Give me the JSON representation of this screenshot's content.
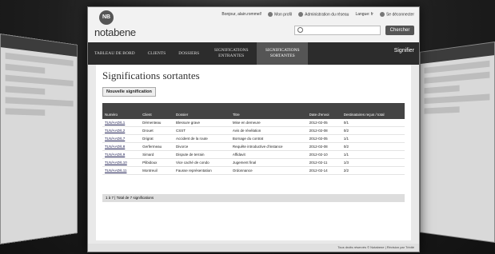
{
  "header": {
    "logo_badge": "NB",
    "logo_text": "notabene",
    "user_link": "Bonjour, alain.rommel!",
    "profile_link": "Mon profil",
    "admin_link": "Administration du réseau",
    "language": "Langue: fr",
    "logout_link": "Se déconnecter",
    "search_button": "Chercher"
  },
  "nav": {
    "items": [
      {
        "label": "TABLEAU DE BORD"
      },
      {
        "label": "CLIENTS"
      },
      {
        "label": "DOSSIERS"
      },
      {
        "label": "SIGNIFICATIONS ENTRANTES"
      },
      {
        "label": "SIGNIFICATIONS SORTANTES"
      }
    ],
    "right_label": "Signifier"
  },
  "page": {
    "title": "Significations sortantes",
    "new_button": "Nouvelle signification"
  },
  "table": {
    "columns": [
      "Numéro",
      "Client",
      "Dossier",
      "Titre",
      "Date d'envoi",
      "Destinataires reçus / total"
    ],
    "rows": [
      [
        "TLN/AAD/L1",
        "Démenteau",
        "Blessure grave",
        "Mise en demeure",
        "2012-02-05",
        "0/1"
      ],
      [
        "TLN/AAD/L2",
        "Drouet",
        "CSST",
        "Avis de révélation",
        "2012-02-08",
        "0/2"
      ],
      [
        "TLN/AAD/L7",
        "Drigrat",
        "Accident de la route",
        "Bornage du contrat",
        "2012-02-05",
        "1/1"
      ],
      [
        "TLN/AAD/L8",
        "Gerfermeau",
        "Divorce",
        "Requête introductive d'instance",
        "2012-02-08",
        "0/2"
      ],
      [
        "TLN/AAD/L9",
        "Simard",
        "Dispute de terrain",
        "Affidavit",
        "2012-02-10",
        "1/1"
      ],
      [
        "TLN/AAD/L10",
        "Plibidoux",
        "Vice caché de condo",
        "Jugement final",
        "2012-02-11",
        "1/3"
      ],
      [
        "TLN/AAD/L11",
        "Montreuil",
        "Fausse représentation",
        "Ordonnance",
        "2012-02-14",
        "2/2"
      ]
    ],
    "footer": "1 à 7  |  Total de 7 significations"
  },
  "bottom": {
    "text": "Tous droits réservés © Notabene  |  Révision par Trinité"
  }
}
